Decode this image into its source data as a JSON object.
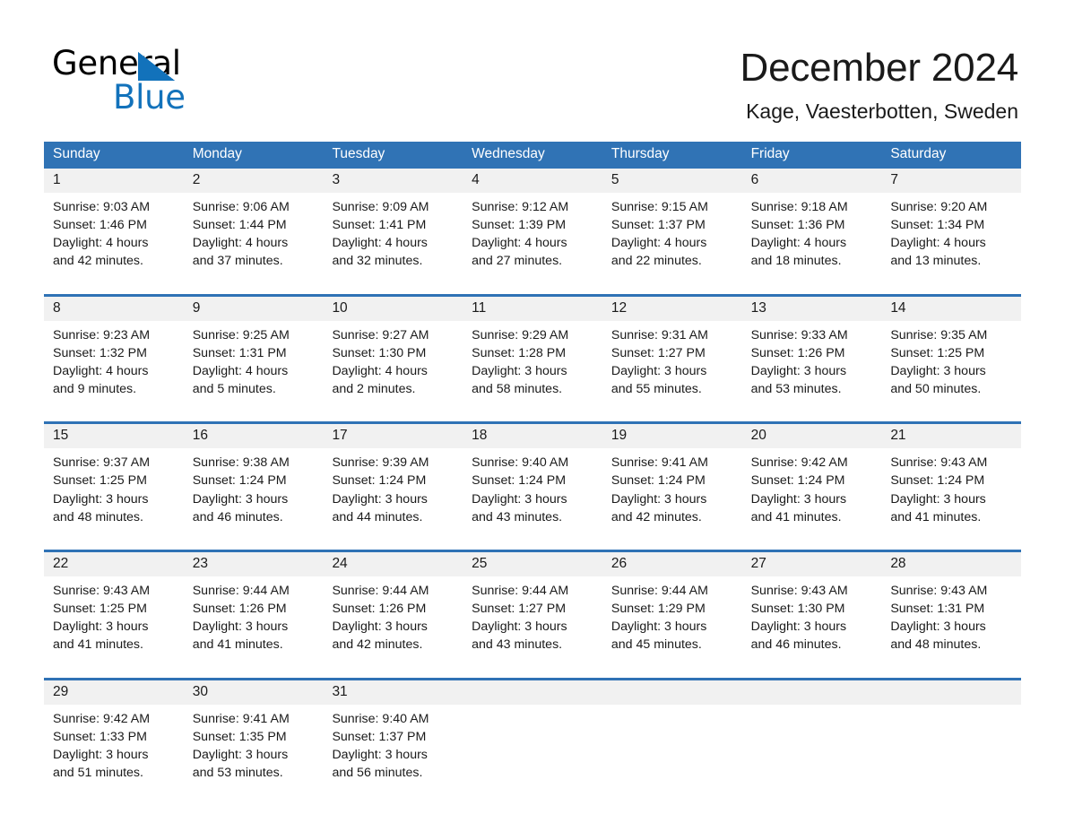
{
  "brand": {
    "name_part1": "General",
    "name_part2": "Blue",
    "accent_color": "#1272bb",
    "triangle_icon": "blue-triangle-icon"
  },
  "header": {
    "title": "December 2024",
    "location": "Kage, Vaesterbotten, Sweden"
  },
  "calendar": {
    "header_bg": "#3073b5",
    "header_text_color": "#ffffff",
    "row_border_color": "#2f72b5",
    "daynum_band_color": "#f1f1f1",
    "weekdays": [
      "Sunday",
      "Monday",
      "Tuesday",
      "Wednesday",
      "Thursday",
      "Friday",
      "Saturday"
    ],
    "weeks": [
      [
        {
          "day": "1",
          "sunrise": "Sunrise: 9:03 AM",
          "sunset": "Sunset: 1:46 PM",
          "daylight_line1": "Daylight: 4 hours",
          "daylight_line2": "and 42 minutes."
        },
        {
          "day": "2",
          "sunrise": "Sunrise: 9:06 AM",
          "sunset": "Sunset: 1:44 PM",
          "daylight_line1": "Daylight: 4 hours",
          "daylight_line2": "and 37 minutes."
        },
        {
          "day": "3",
          "sunrise": "Sunrise: 9:09 AM",
          "sunset": "Sunset: 1:41 PM",
          "daylight_line1": "Daylight: 4 hours",
          "daylight_line2": "and 32 minutes."
        },
        {
          "day": "4",
          "sunrise": "Sunrise: 9:12 AM",
          "sunset": "Sunset: 1:39 PM",
          "daylight_line1": "Daylight: 4 hours",
          "daylight_line2": "and 27 minutes."
        },
        {
          "day": "5",
          "sunrise": "Sunrise: 9:15 AM",
          "sunset": "Sunset: 1:37 PM",
          "daylight_line1": "Daylight: 4 hours",
          "daylight_line2": "and 22 minutes."
        },
        {
          "day": "6",
          "sunrise": "Sunrise: 9:18 AM",
          "sunset": "Sunset: 1:36 PM",
          "daylight_line1": "Daylight: 4 hours",
          "daylight_line2": "and 18 minutes."
        },
        {
          "day": "7",
          "sunrise": "Sunrise: 9:20 AM",
          "sunset": "Sunset: 1:34 PM",
          "daylight_line1": "Daylight: 4 hours",
          "daylight_line2": "and 13 minutes."
        }
      ],
      [
        {
          "day": "8",
          "sunrise": "Sunrise: 9:23 AM",
          "sunset": "Sunset: 1:32 PM",
          "daylight_line1": "Daylight: 4 hours",
          "daylight_line2": "and 9 minutes."
        },
        {
          "day": "9",
          "sunrise": "Sunrise: 9:25 AM",
          "sunset": "Sunset: 1:31 PM",
          "daylight_line1": "Daylight: 4 hours",
          "daylight_line2": "and 5 minutes."
        },
        {
          "day": "10",
          "sunrise": "Sunrise: 9:27 AM",
          "sunset": "Sunset: 1:30 PM",
          "daylight_line1": "Daylight: 4 hours",
          "daylight_line2": "and 2 minutes."
        },
        {
          "day": "11",
          "sunrise": "Sunrise: 9:29 AM",
          "sunset": "Sunset: 1:28 PM",
          "daylight_line1": "Daylight: 3 hours",
          "daylight_line2": "and 58 minutes."
        },
        {
          "day": "12",
          "sunrise": "Sunrise: 9:31 AM",
          "sunset": "Sunset: 1:27 PM",
          "daylight_line1": "Daylight: 3 hours",
          "daylight_line2": "and 55 minutes."
        },
        {
          "day": "13",
          "sunrise": "Sunrise: 9:33 AM",
          "sunset": "Sunset: 1:26 PM",
          "daylight_line1": "Daylight: 3 hours",
          "daylight_line2": "and 53 minutes."
        },
        {
          "day": "14",
          "sunrise": "Sunrise: 9:35 AM",
          "sunset": "Sunset: 1:25 PM",
          "daylight_line1": "Daylight: 3 hours",
          "daylight_line2": "and 50 minutes."
        }
      ],
      [
        {
          "day": "15",
          "sunrise": "Sunrise: 9:37 AM",
          "sunset": "Sunset: 1:25 PM",
          "daylight_line1": "Daylight: 3 hours",
          "daylight_line2": "and 48 minutes."
        },
        {
          "day": "16",
          "sunrise": "Sunrise: 9:38 AM",
          "sunset": "Sunset: 1:24 PM",
          "daylight_line1": "Daylight: 3 hours",
          "daylight_line2": "and 46 minutes."
        },
        {
          "day": "17",
          "sunrise": "Sunrise: 9:39 AM",
          "sunset": "Sunset: 1:24 PM",
          "daylight_line1": "Daylight: 3 hours",
          "daylight_line2": "and 44 minutes."
        },
        {
          "day": "18",
          "sunrise": "Sunrise: 9:40 AM",
          "sunset": "Sunset: 1:24 PM",
          "daylight_line1": "Daylight: 3 hours",
          "daylight_line2": "and 43 minutes."
        },
        {
          "day": "19",
          "sunrise": "Sunrise: 9:41 AM",
          "sunset": "Sunset: 1:24 PM",
          "daylight_line1": "Daylight: 3 hours",
          "daylight_line2": "and 42 minutes."
        },
        {
          "day": "20",
          "sunrise": "Sunrise: 9:42 AM",
          "sunset": "Sunset: 1:24 PM",
          "daylight_line1": "Daylight: 3 hours",
          "daylight_line2": "and 41 minutes."
        },
        {
          "day": "21",
          "sunrise": "Sunrise: 9:43 AM",
          "sunset": "Sunset: 1:24 PM",
          "daylight_line1": "Daylight: 3 hours",
          "daylight_line2": "and 41 minutes."
        }
      ],
      [
        {
          "day": "22",
          "sunrise": "Sunrise: 9:43 AM",
          "sunset": "Sunset: 1:25 PM",
          "daylight_line1": "Daylight: 3 hours",
          "daylight_line2": "and 41 minutes."
        },
        {
          "day": "23",
          "sunrise": "Sunrise: 9:44 AM",
          "sunset": "Sunset: 1:26 PM",
          "daylight_line1": "Daylight: 3 hours",
          "daylight_line2": "and 41 minutes."
        },
        {
          "day": "24",
          "sunrise": "Sunrise: 9:44 AM",
          "sunset": "Sunset: 1:26 PM",
          "daylight_line1": "Daylight: 3 hours",
          "daylight_line2": "and 42 minutes."
        },
        {
          "day": "25",
          "sunrise": "Sunrise: 9:44 AM",
          "sunset": "Sunset: 1:27 PM",
          "daylight_line1": "Daylight: 3 hours",
          "daylight_line2": "and 43 minutes."
        },
        {
          "day": "26",
          "sunrise": "Sunrise: 9:44 AM",
          "sunset": "Sunset: 1:29 PM",
          "daylight_line1": "Daylight: 3 hours",
          "daylight_line2": "and 45 minutes."
        },
        {
          "day": "27",
          "sunrise": "Sunrise: 9:43 AM",
          "sunset": "Sunset: 1:30 PM",
          "daylight_line1": "Daylight: 3 hours",
          "daylight_line2": "and 46 minutes."
        },
        {
          "day": "28",
          "sunrise": "Sunrise: 9:43 AM",
          "sunset": "Sunset: 1:31 PM",
          "daylight_line1": "Daylight: 3 hours",
          "daylight_line2": "and 48 minutes."
        }
      ],
      [
        {
          "day": "29",
          "sunrise": "Sunrise: 9:42 AM",
          "sunset": "Sunset: 1:33 PM",
          "daylight_line1": "Daylight: 3 hours",
          "daylight_line2": "and 51 minutes."
        },
        {
          "day": "30",
          "sunrise": "Sunrise: 9:41 AM",
          "sunset": "Sunset: 1:35 PM",
          "daylight_line1": "Daylight: 3 hours",
          "daylight_line2": "and 53 minutes."
        },
        {
          "day": "31",
          "sunrise": "Sunrise: 9:40 AM",
          "sunset": "Sunset: 1:37 PM",
          "daylight_line1": "Daylight: 3 hours",
          "daylight_line2": "and 56 minutes."
        },
        {
          "day": "",
          "sunrise": "",
          "sunset": "",
          "daylight_line1": "",
          "daylight_line2": ""
        },
        {
          "day": "",
          "sunrise": "",
          "sunset": "",
          "daylight_line1": "",
          "daylight_line2": ""
        },
        {
          "day": "",
          "sunrise": "",
          "sunset": "",
          "daylight_line1": "",
          "daylight_line2": ""
        },
        {
          "day": "",
          "sunrise": "",
          "sunset": "",
          "daylight_line1": "",
          "daylight_line2": ""
        }
      ]
    ]
  }
}
